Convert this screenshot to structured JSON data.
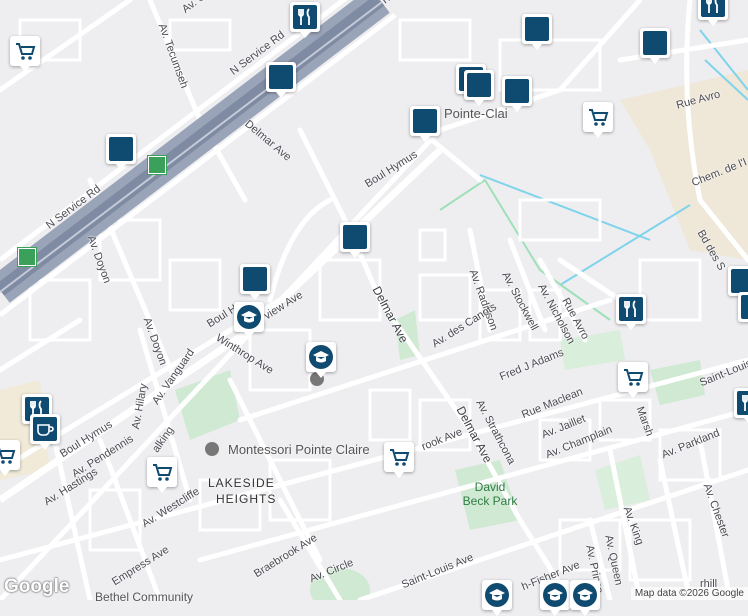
{
  "streets": {
    "n_service_rd_top": "N Service Rd",
    "n_service_rd_left": "N Service Rd",
    "tecumseh": "Av. Tecumseh",
    "delmar_top": "Delmar Ave",
    "boul_hymus_top": "Boul Hymus",
    "boul_hymus_left": "Boul Hymus",
    "boul_left": "Boul H",
    "doyon_1": "Av. Doyon",
    "doyon_2": "Av. Doyon",
    "delmar_mid": "Delmar Ave",
    "delmar_bottom": "Delmar Ave",
    "radisson": "Av. Radisson",
    "stockwell": "Av. Stockwell",
    "nicholson": "Av. Nicholson",
    "rue_avro_1": "Rue Avro",
    "rue_avro_2": "Rue Avro",
    "chem": "Chem. de l'I",
    "bd_des": "Bd des S",
    "des_canots": "Av. des Canots",
    "fred_adams": "Fred J Adams",
    "rue_maclean": "Rue Maclean",
    "jaillet": "Av. Jaillet",
    "strathcona": "Av. Strathcona",
    "champlain": "Av. Champlain",
    "saint_louis_right": "Saint-Louis",
    "parkland": "Av. Parkland",
    "chester": "Av. Chester",
    "king": "Av. King",
    "queen": "Av. Queen",
    "prince": "Av. Prince",
    "brook": "rook Ave",
    "winthrop": "Winthrop Ave",
    "view": "view Ave",
    "vanguard": "Av. Vanguard",
    "hilary": "Av. Hilary",
    "pendennis": "Av. Pendennis",
    "hastings": "Av. Hastings",
    "westcliffe": "Av. Westcliffe",
    "empress": "Empress Ave",
    "braebrook": "Braebrook Ave",
    "circle": "Av. Circle",
    "saint_louis_ave": "Saint-Louis Ave",
    "fisher": "h-Fisher Ave",
    "ohio": "Av. Ohi",
    "walking": "alking",
    "marsh": "Marsh",
    "shell": "rhill",
    "top_right_tr": "Tr"
  },
  "places": {
    "lakeside_heights_1": "LAKESIDE",
    "lakeside_heights_2": "HEIGHTS",
    "montessori": "Montessori Pointe Claire",
    "pointe_claire": "Pointe-Clai",
    "david_beck_1": "David",
    "david_beck_2": "Beck Park",
    "bethel": "Bethel Community"
  },
  "pins": [
    {
      "name": "shopping-cart-pin",
      "icon": "cart"
    },
    {
      "name": "shopping-bag-pin",
      "icon": "bag"
    },
    {
      "name": "restaurant-pin",
      "icon": "fork"
    },
    {
      "name": "school-pin",
      "icon": "school"
    },
    {
      "name": "cafe-pin",
      "icon": "cup"
    }
  ],
  "highway_shield_color": "#3aa05a",
  "pin_color": "#0f4a70",
  "attribution": {
    "logo": "Google",
    "map_data": "Map data ©2026 Google"
  }
}
